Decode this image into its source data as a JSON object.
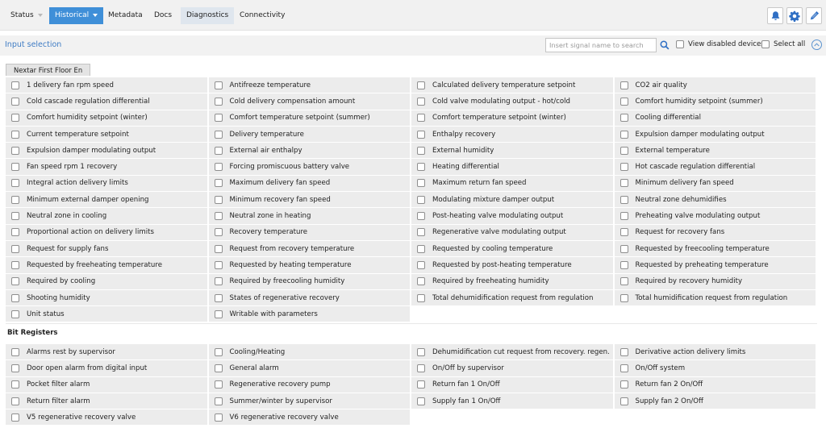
{
  "nav": {
    "tabs": [
      {
        "label": "Status"
      },
      {
        "label": "Historical"
      },
      {
        "label": "Metadata"
      },
      {
        "label": "Docs"
      },
      {
        "label": "Diagnostics"
      },
      {
        "label": "Connectivity"
      }
    ],
    "active_tab": "Historical",
    "icons": [
      "bell-icon",
      "gear-icon",
      "pencil-icon"
    ],
    "accent_color": "#3f8fd8"
  },
  "input_selection": {
    "title": "Input selection",
    "search_placeholder": "Insert signal name to search",
    "view_disabled_label": "View disabled devices",
    "select_all_label": "Select all"
  },
  "device_tab": {
    "label": "Nextar First Floor En"
  },
  "analog_signals": [
    "1 delivery fan rpm speed",
    "Antifreeze temperature",
    "Calculated delivery temperature setpoint",
    "CO2 air quality",
    "Cold cascade regulation differential",
    "Cold delivery compensation amount",
    "Cold valve modulating output - hot/cold",
    "Comfort humidity setpoint (summer)",
    "Comfort humidity setpoint (winter)",
    "Comfort temperature setpoint (summer)",
    "Comfort temperature setpoint (winter)",
    "Cooling differential",
    "Current temperature setpoint",
    "Delivery temperature",
    "Enthalpy recovery",
    "Expulsion damper modulating output",
    "Expulsion damper modulating output",
    "External air enthalpy",
    "External humidity",
    "External temperature",
    "Fan speed rpm 1 recovery",
    "Forcing promiscuous battery valve",
    "Heating differential",
    "Hot cascade regulation differential",
    "Integral action delivery limits",
    "Maximum delivery fan speed",
    "Maximum return fan speed",
    "Minimum delivery fan speed",
    "Minimum external damper opening",
    "Minimum recovery fan speed",
    "Modulating mixture damper output",
    "Neutral zone dehumidifies",
    "Neutral zone in cooling",
    "Neutral zone in heating",
    "Post-heating valve modulating output",
    "Preheating valve modulating output",
    "Proportional action on delivery limits",
    "Recovery temperature",
    "Regenerative valve modulating output",
    "Request for recovery fans",
    "Request for supply fans",
    "Request from recovery temperature",
    "Requested by cooling temperature",
    "Requested by freecooling temperature",
    "Requested by freeheating temperature",
    "Requested by heating temperature",
    "Requested by post-heating temperature",
    "Requested by preheating temperature",
    "Required by cooling",
    "Required by freecooling humidity",
    "Required by freeheating humidity",
    "Required by recovery humidity",
    "Shooting humidity",
    "States of regenerative recovery",
    "Total dehumidification request from regulation",
    "Total humidification request from regulation",
    "Unit status",
    "Writable with parameters"
  ],
  "bit_registers": {
    "title": "Bit Registers",
    "items": [
      "Alarms rest by supervisor",
      "Cooling/Heating",
      "Dehumidification cut request from recovery. regen.",
      "Derivative action delivery limits",
      "Door open alarm from digital input",
      "General alarm",
      "On/Off by supervisor",
      "On/Off system",
      "Pocket filter alarm",
      "Regenerative recovery pump",
      "Return fan 1 On/Off",
      "Return fan 2 On/Off",
      "Return filter alarm",
      "Summer/winter by supervisor",
      "Supply fan 1 On/Off",
      "Supply fan 2 On/Off",
      "V5 regenerative recovery valve",
      "V6 regenerative recovery valve"
    ]
  }
}
